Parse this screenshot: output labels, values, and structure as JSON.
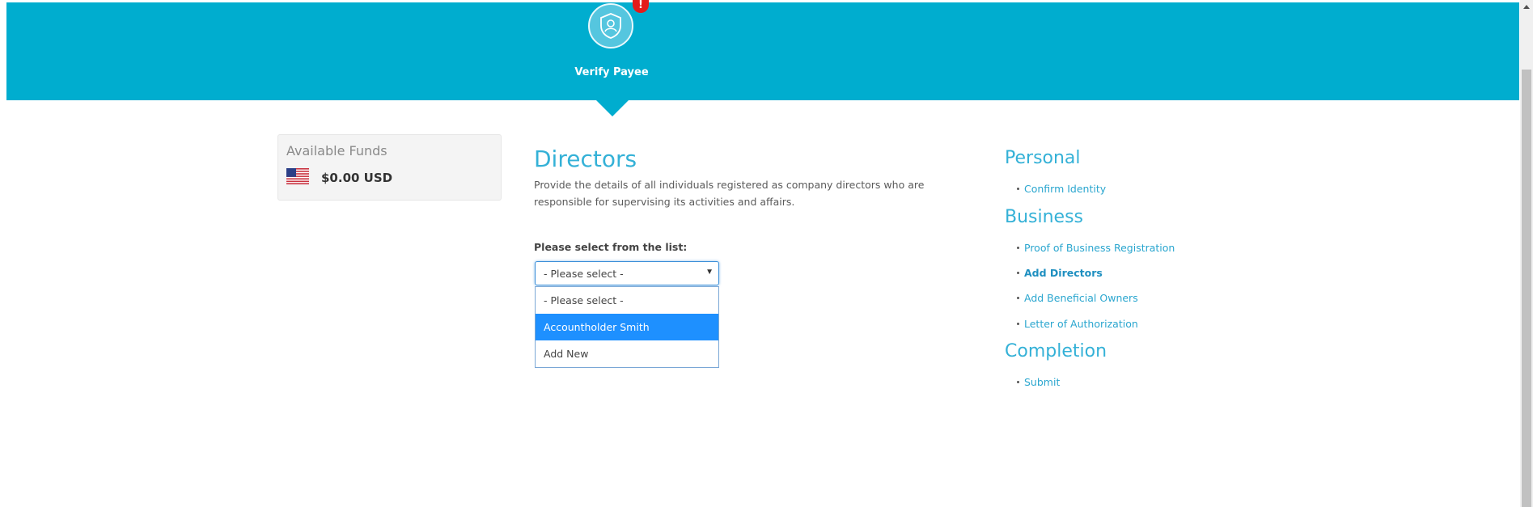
{
  "banner": {
    "step_label": "Verify Payee",
    "alert_badge": "!",
    "color": "#00adcf",
    "icon": "shield-user-icon"
  },
  "funds": {
    "title": "Available Funds",
    "amount": "$0.00 USD",
    "flag_icon": "us-flag-icon"
  },
  "main": {
    "title": "Directors",
    "description": "Provide the details of all individuals registered as company directors who are responsible for supervising its activities and affairs.",
    "select_label": "Please select from the list:",
    "select_value": "- Please select -",
    "options": [
      "- Please select -",
      "Accountholder Smith",
      "Add New"
    ],
    "highlighted_option": "Accountholder Smith"
  },
  "sidebar": {
    "sections": [
      {
        "title": "Personal",
        "items": [
          {
            "label": "Confirm Identity"
          }
        ]
      },
      {
        "title": "Business",
        "items": [
          {
            "label": "Proof of Business Registration"
          },
          {
            "label": "Add Directors",
            "active": true
          },
          {
            "label": "Add Beneficial Owners"
          },
          {
            "label": "Letter of Authorization"
          }
        ]
      },
      {
        "title": "Completion",
        "items": [
          {
            "label": "Submit"
          }
        ]
      }
    ]
  },
  "colors": {
    "accent": "#34b1d7",
    "link": "#2aa6cf",
    "highlight": "#1e90ff",
    "badge": "#e31b1b"
  }
}
